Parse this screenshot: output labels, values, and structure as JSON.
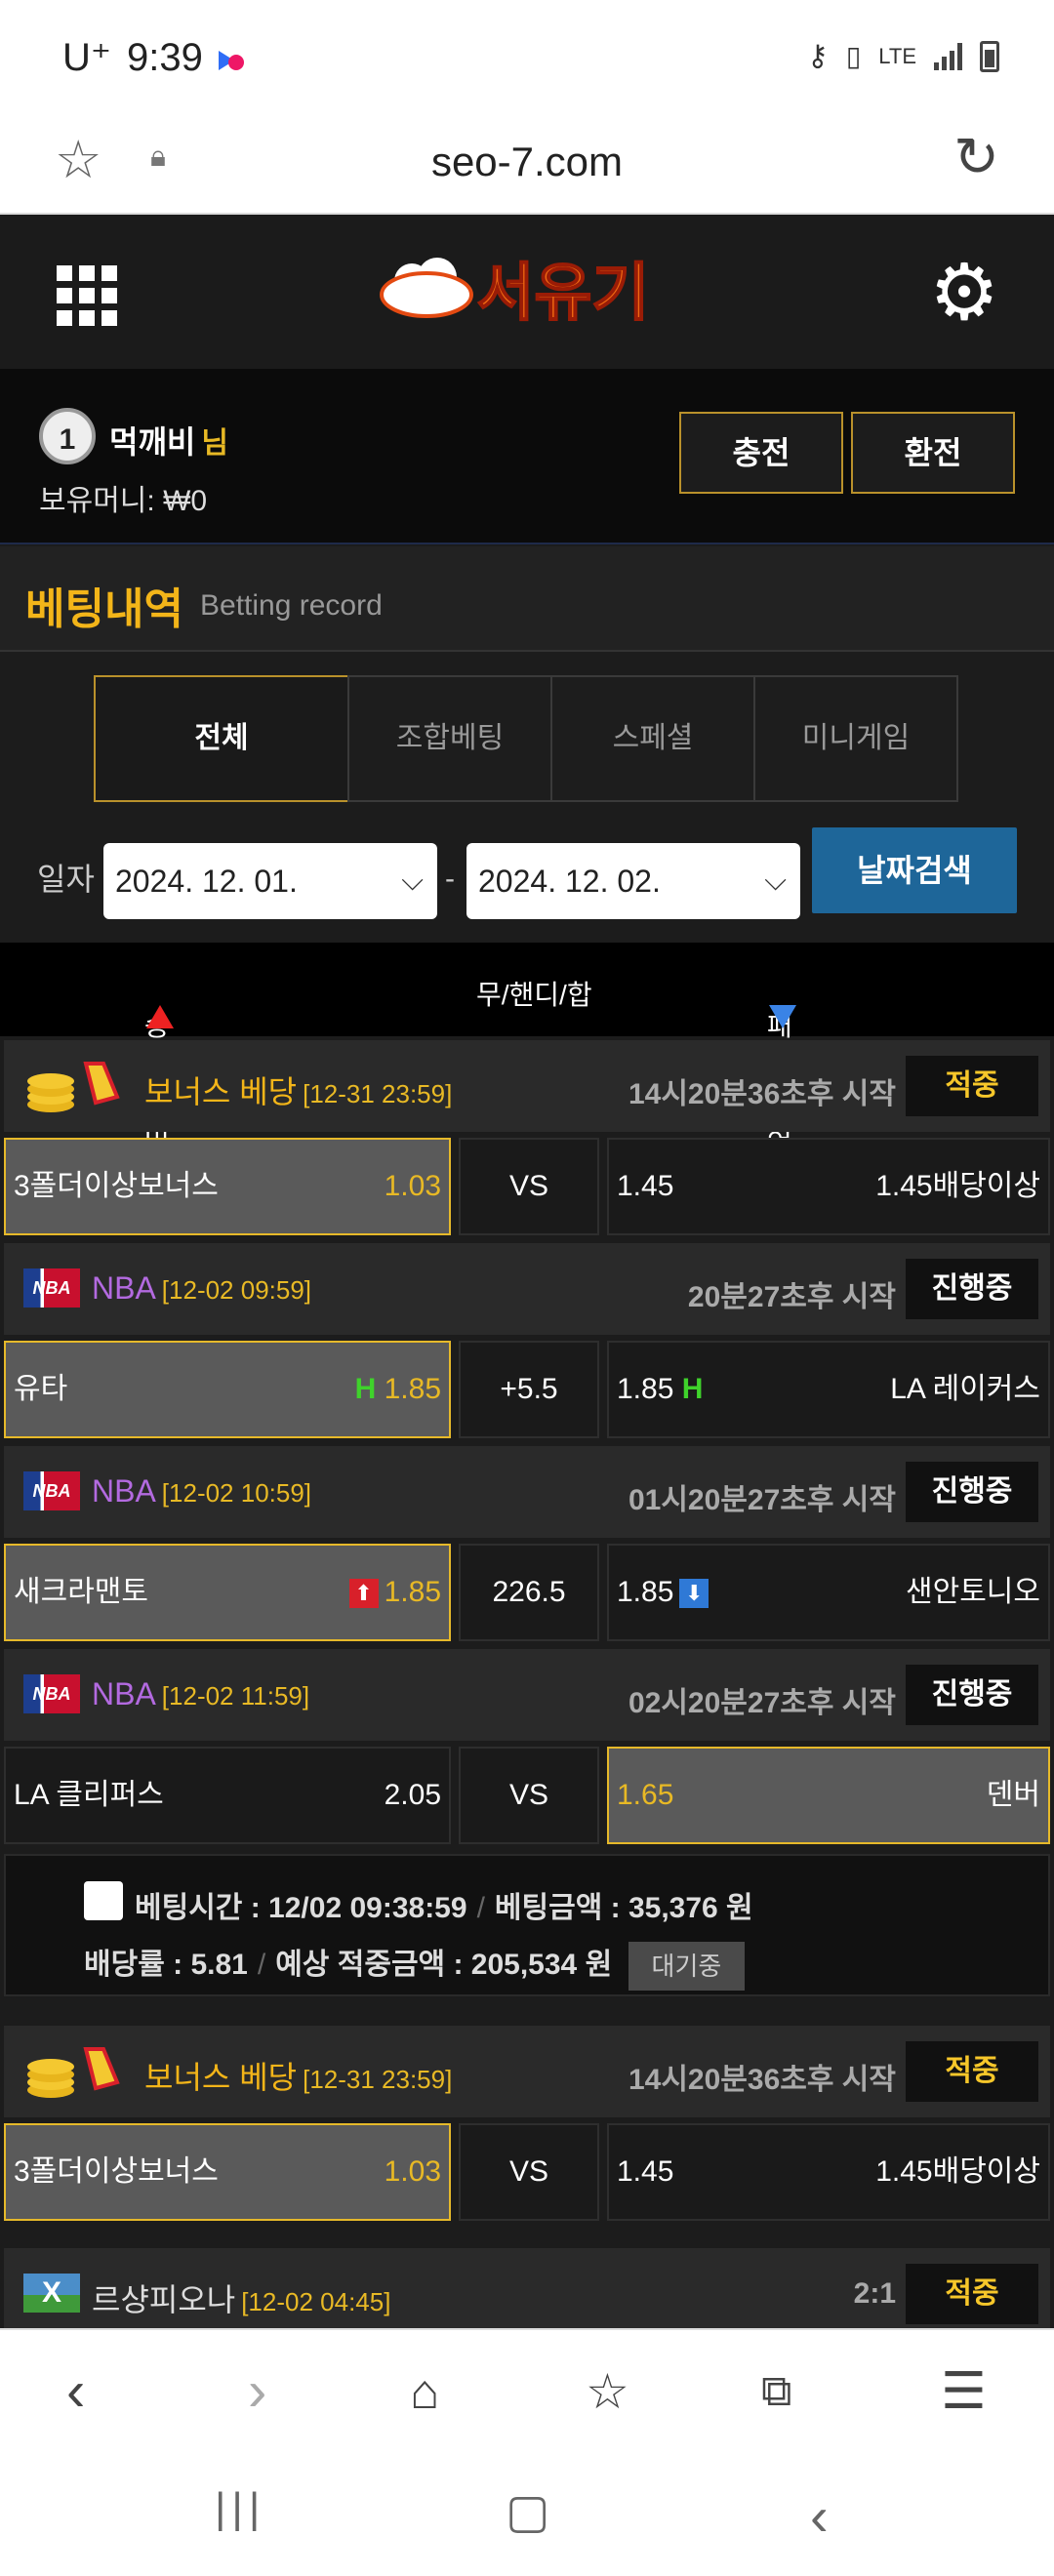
{
  "status": {
    "carrier": "U⁺",
    "time": "9:39",
    "network": "LTE"
  },
  "browser": {
    "url": "seo-7.com"
  },
  "site": {
    "logo_text": "서유기"
  },
  "user": {
    "level": "1",
    "name": "먹깨비",
    "suffix": "님",
    "money_label": "보유머니: ₩0",
    "charge": "충전",
    "exchange": "환전"
  },
  "page": {
    "title": "베팅내역",
    "subtitle": "Betting record"
  },
  "tabs": [
    "전체",
    "조합베팅",
    "스페셜",
    "미니게임"
  ],
  "date": {
    "label": "일자",
    "from": "2024. 12. 01.",
    "to": "2024. 12. 02.",
    "search": "날짜검색"
  },
  "columns": {
    "home": "승(홈)오버",
    "draw": "무/핸디/합",
    "away": "패(원정)언더"
  },
  "games": [
    {
      "league": "보너스 베당",
      "date": "[12-31 23:59]",
      "time": "14시20분36초후 시작",
      "status": "적중",
      "home": "3폴더이상보너스",
      "home_odds": "1.03",
      "mid": "VS",
      "away_odds": "1.45",
      "away": "1.45배당이상"
    },
    {
      "league": "NBA",
      "date": "[12-02 09:59]",
      "time": "20분27초후 시작",
      "status": "진행중",
      "home": "유타",
      "home_mark": "H",
      "home_odds": "1.85",
      "mid": "+5.5",
      "away_odds": "1.85",
      "away_mark": "H",
      "away": "LA 레이커스"
    },
    {
      "league": "NBA",
      "date": "[12-02 10:59]",
      "time": "01시20분27초후 시작",
      "status": "진행중",
      "home": "새크라맨토",
      "home_odds": "1.85",
      "mid": "226.5",
      "away_odds": "1.85",
      "away": "샌안토니오"
    },
    {
      "league": "NBA",
      "date": "[12-02 11:59]",
      "time": "02시20분27초후 시작",
      "status": "진행중",
      "home": "LA 클리퍼스",
      "home_odds": "2.05",
      "mid": "VS",
      "away_odds": "1.65",
      "away": "덴버"
    }
  ],
  "summary": {
    "bet_time_label": "베팅시간 : 12/02 09:38:59",
    "bet_amount_label": "베팅금액 : 35,376 원",
    "rate_label": "배당률 : 5.81",
    "expected_label": "예상 적중금액 : 205,534 원",
    "state": "대기중"
  },
  "games2": [
    {
      "league": "보너스 베당",
      "date": "[12-31 23:59]",
      "time": "14시20분36초후 시작",
      "status": "적중",
      "home": "3폴더이상보너스",
      "home_odds": "1.03",
      "mid": "VS",
      "away_odds": "1.45",
      "away": "1.45배당이상"
    },
    {
      "league": "르샹피오나",
      "date": "[12-02 04:45]",
      "time": "2:1",
      "status": "적중"
    }
  ],
  "colors": {
    "accent": "#f3b519",
    "search_button": "#1e6699",
    "win": "#f7c72a"
  }
}
